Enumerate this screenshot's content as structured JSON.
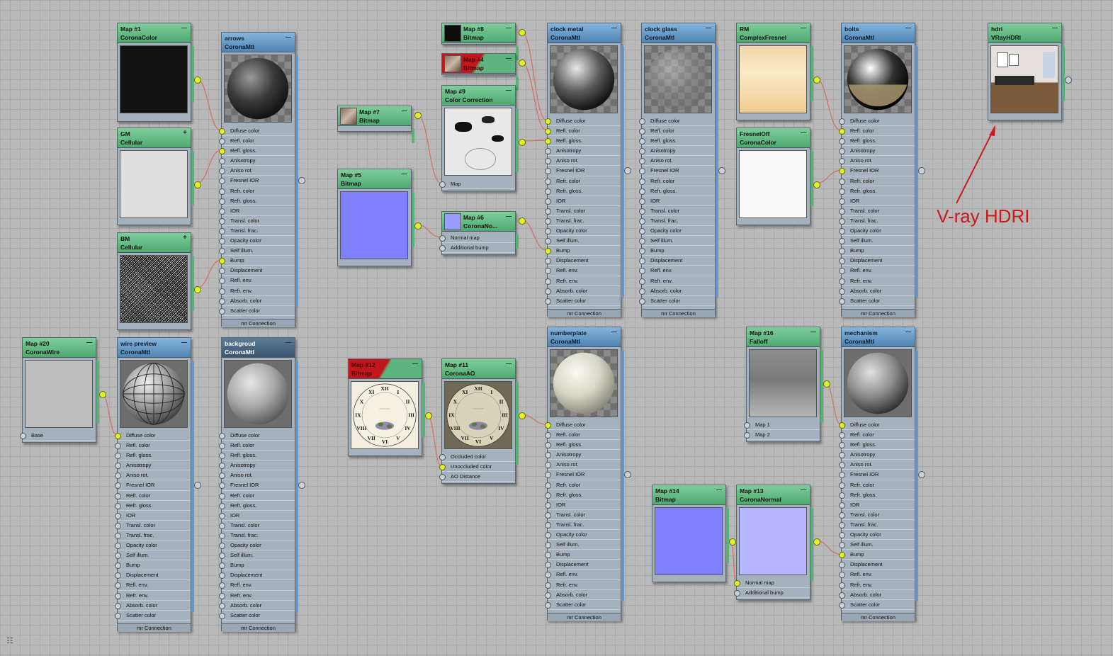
{
  "canvas": {
    "background": "#b9b9b9",
    "grid_color": "#a9a9a9"
  },
  "annotation": {
    "label": "V-ray HDRI",
    "color": "#cc1a1a"
  },
  "nodes": [
    {
      "id": "map1",
      "title": "Map #1",
      "subtitle": "CoronaColor",
      "kind": "map",
      "preview": "black"
    },
    {
      "id": "gm",
      "title": "GM",
      "subtitle": "Cellular",
      "kind": "map",
      "preview": "light-noise"
    },
    {
      "id": "bm",
      "title": "BM",
      "subtitle": "Cellular",
      "kind": "map",
      "preview": "dark-noise"
    },
    {
      "id": "arrows",
      "title": "arrows",
      "subtitle": "CoronaMtl",
      "kind": "mtl",
      "preview": "dark-sphere",
      "footer": "mr Connection"
    },
    {
      "id": "map20",
      "title": "Map #20",
      "subtitle": "CoronaWire",
      "kind": "map",
      "preview": "gray",
      "slots": [
        "Base"
      ]
    },
    {
      "id": "wire",
      "title": "wire preview",
      "subtitle": "CoronaMtl",
      "kind": "mtl",
      "preview": "wire-sphere",
      "footer": "mr Connection"
    },
    {
      "id": "backgroud",
      "title": "backgroud",
      "subtitle": "CoronaMtl",
      "kind": "dark",
      "preview": "gray-sphere",
      "footer": "mr Connection"
    },
    {
      "id": "map7",
      "title": "Map #7",
      "subtitle": "Bitmap",
      "kind": "map",
      "preview": "small-tex"
    },
    {
      "id": "map5",
      "title": "Map #5",
      "subtitle": "Bitmap",
      "kind": "map",
      "preview": "normal-blue"
    },
    {
      "id": "map8",
      "title": "Map #8",
      "subtitle": "Bitmap",
      "kind": "map",
      "preview": "black-small"
    },
    {
      "id": "map4",
      "title": "Map #4",
      "subtitle": "Bitmap",
      "kind": "red",
      "preview": "small-tex"
    },
    {
      "id": "map9",
      "title": "Map #9",
      "subtitle": "Color Correction",
      "kind": "map",
      "preview": "cc",
      "slots": [
        "Map"
      ]
    },
    {
      "id": "map6",
      "title": "Map #6",
      "subtitle": "CoronaNo...",
      "kind": "map",
      "preview": "normal-small",
      "slots": [
        "Normal map",
        "Additional bump"
      ]
    },
    {
      "id": "map12",
      "title": "Map #12",
      "subtitle": "Bitmap",
      "kind": "red",
      "preview": "clock"
    },
    {
      "id": "map11",
      "title": "Map #11",
      "subtitle": "CoronaAO",
      "kind": "map",
      "preview": "clock-ao",
      "slots": [
        "Occluded color",
        "Unoccluded color",
        "AO Distance"
      ]
    },
    {
      "id": "clockmetal",
      "title": "clock metal",
      "subtitle": "CoronaMtl",
      "kind": "mtl",
      "preview": "metal-sphere",
      "footer": "mr Connection"
    },
    {
      "id": "clockglass",
      "title": "clock glass",
      "subtitle": "CoronaMtl",
      "kind": "mtl",
      "preview": "glass-sphere",
      "footer": "mr Connection"
    },
    {
      "id": "numberplate",
      "title": "numberplate",
      "subtitle": "CoronaMtl",
      "kind": "mtl",
      "preview": "plate-sphere",
      "footer": "mr Connection"
    },
    {
      "id": "rm",
      "title": "RM",
      "subtitle": "ComplexFresnel",
      "kind": "map",
      "preview": "fresnel"
    },
    {
      "id": "fresneloff",
      "title": "FresnelOff",
      "subtitle": "CoronaColor",
      "kind": "map",
      "preview": "white"
    },
    {
      "id": "map16",
      "title": "Map #16",
      "subtitle": "Falloff",
      "kind": "map",
      "preview": "falloff",
      "slots": [
        "Map 1",
        "Map 2"
      ]
    },
    {
      "id": "map14",
      "title": "Map #14",
      "subtitle": "Bitmap",
      "kind": "map",
      "preview": "normal-blue"
    },
    {
      "id": "map13",
      "title": "Map #13",
      "subtitle": "CoronaNormal",
      "kind": "map",
      "preview": "normal-light",
      "slots": [
        "Normal map",
        "Additional bump"
      ]
    },
    {
      "id": "bolts",
      "title": "bolts",
      "subtitle": "CoronaMtl",
      "kind": "mtl",
      "preview": "chrome-sphere",
      "footer": "mr Connection"
    },
    {
      "id": "mechanism",
      "title": "mechanism",
      "subtitle": "CoronaMtl",
      "kind": "mtl",
      "preview": "gray-sphere2",
      "footer": "mr Connection"
    },
    {
      "id": "hdri",
      "title": "hdri",
      "subtitle": "VRayHDRI",
      "kind": "map",
      "preview": "room"
    }
  ],
  "material_slots": [
    "Diffuse color",
    "Refl. color",
    "Refl. gloss.",
    "Anisotropy",
    "Aniso rot.",
    "Fresnel IOR",
    "Refr. color",
    "Refr. gloss.",
    "IOR",
    "Transl. color",
    "Transl. frac.",
    "Opacity color",
    "Self illum.",
    "Bump",
    "Displacement",
    "Refl. env.",
    "Refr. env.",
    "Absorb. color",
    "Scatter color"
  ],
  "clock_numerals": [
    "XII",
    "I",
    "II",
    "III",
    "IV",
    "V",
    "VI",
    "VII",
    "VIII",
    "IX",
    "X",
    "XI"
  ]
}
